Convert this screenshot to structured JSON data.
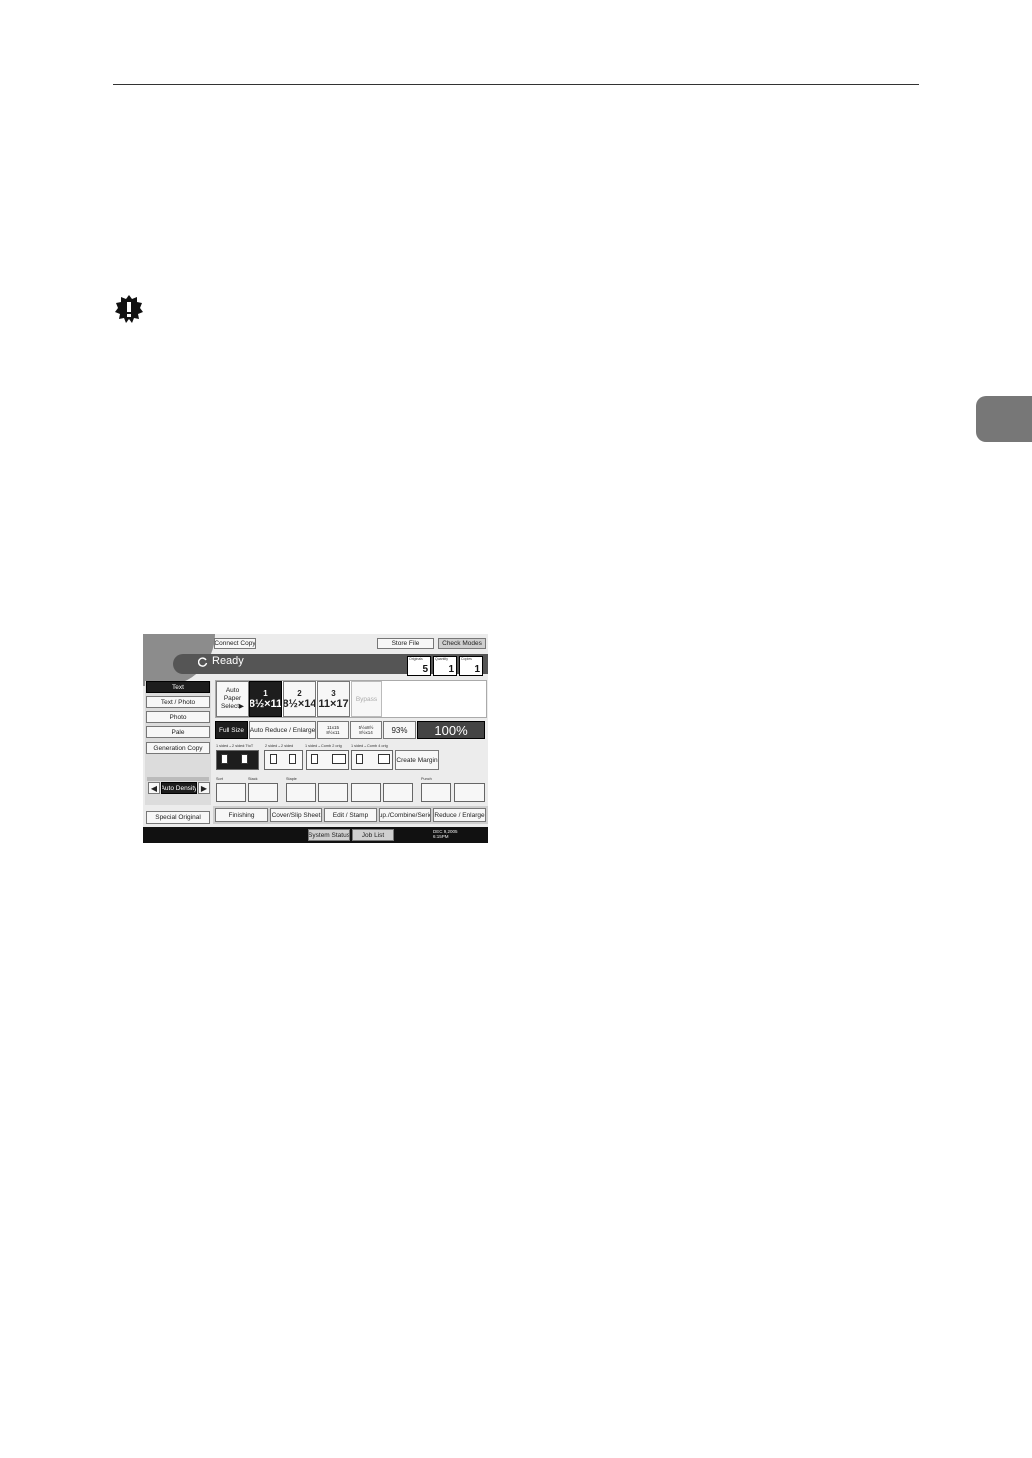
{
  "copier_panel": {
    "status": "Ready",
    "top_buttons": {
      "connect_copy": "Connect Copy",
      "store_file": "Store File",
      "check_modes": "Check Modes"
    },
    "counters": [
      {
        "label": "Originals",
        "value": "5"
      },
      {
        "label": "Quantity",
        "value": "1"
      },
      {
        "label": "Copies",
        "value": "1"
      }
    ],
    "original_types": [
      "Text",
      "Text / Photo",
      "Photo",
      "Pale",
      "Generation Copy"
    ],
    "selected_original_type": "Text",
    "auto_paper_select": "Auto Paper Select▶",
    "trays": [
      {
        "number": "1",
        "size": "8½×11",
        "selected": true
      },
      {
        "number": "2",
        "size": "8½×14",
        "selected": false
      },
      {
        "number": "3",
        "size": "11×17",
        "selected": false
      }
    ],
    "bypass": "Bypass",
    "ratio_buttons": {
      "full_size": "Full Size",
      "auto_reduce_enlarge": "Auto Reduce / Enlarge",
      "preset_1_top": "11x15",
      "preset_1_bottom": "8½x11",
      "preset_2_top": "5½x8½",
      "preset_2_bottom": "8½x14",
      "percent_93": "93%",
      "current_ratio": "100%"
    },
    "duplex_labels": [
      "1 sided→2 sided:TtoT",
      "2 sided→2 sided",
      "1 sided→Comb 2 orig",
      "1 sided→Comb 4 orig"
    ],
    "create_margin": "Create Margin",
    "auto_density": "Auto Density",
    "finishing_labels": {
      "sort": "Sort",
      "stack": "Stack",
      "staple": "Staple",
      "punch": "Punch"
    },
    "special_original": "Special Original",
    "tabs": [
      "Finishing",
      "Cover/Slip Sheet",
      "Edit / Stamp",
      "Dup./Combine/Series",
      "Reduce / Enlarge"
    ],
    "bottom_buttons": {
      "system_status": "System Status",
      "job_list": "Job List"
    },
    "date": "DEC 9,2005",
    "time": "6:15PM"
  }
}
